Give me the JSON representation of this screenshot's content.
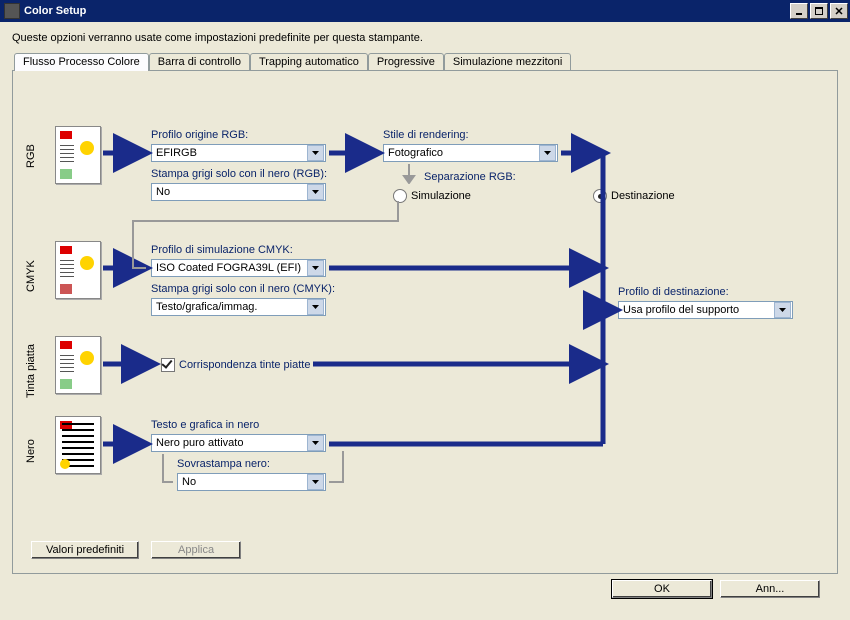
{
  "window": {
    "title": "Color Setup"
  },
  "subtitle": "Queste opzioni verranno usate come impostazioni predefinite per questa stampante.",
  "tabs": {
    "colorflow": "Flusso Processo Colore",
    "controlbar": "Barra di controllo",
    "autotrap": "Trapping automatico",
    "progressive": "Progressive",
    "halftone": "Simulazione mezzitoni"
  },
  "sections": {
    "rgb": "RGB",
    "cmyk": "CMYK",
    "spot": "Tinta piatta",
    "black": "Nero"
  },
  "labels": {
    "rgb_source": "Profilo origine RGB:",
    "gray_rgb": "Stampa grigi solo con il nero (RGB):",
    "rendering": "Stile di rendering:",
    "rgb_sep": "Separazione RGB:",
    "cmyk_sim": "Profilo di simulazione CMYK:",
    "gray_cmyk": "Stampa grigi solo con il nero (CMYK):",
    "spot_match": "Corrispondenza tinte piatte",
    "black_text": "Testo e grafica in nero",
    "overprint": "Sovrastampa nero:",
    "out_profile": "Profilo di destinazione:",
    "radio_sim": "Simulazione",
    "radio_dest": "Destinazione"
  },
  "values": {
    "rgb_source": "EFIRGB",
    "gray_rgb": "No",
    "rendering": "Fotografico",
    "cmyk_sim": "ISO Coated FOGRA39L (EFI)",
    "gray_cmyk": "Testo/grafica/immag.",
    "black_text": "Nero puro attivato",
    "overprint": "No",
    "out_profile": "Usa profilo del supporto",
    "spot_checked": true,
    "rgb_sep_radio": "dest"
  },
  "buttons": {
    "defaults": "Valori predefiniti",
    "apply": "Applica",
    "ok": "OK",
    "cancel": "Ann..."
  }
}
